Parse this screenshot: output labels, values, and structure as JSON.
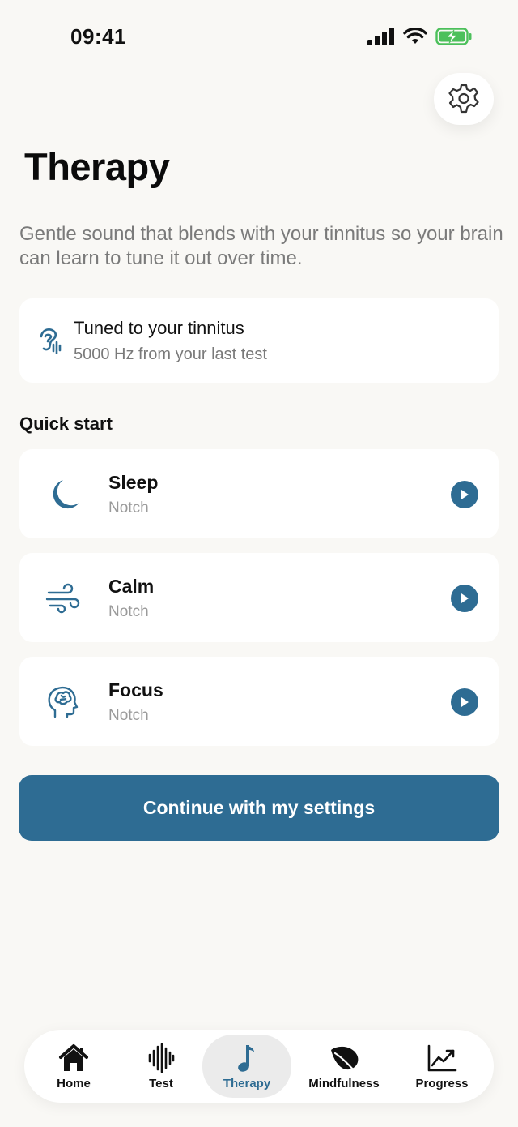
{
  "status_bar": {
    "time": "09:41"
  },
  "header": {
    "title": "Therapy"
  },
  "description": "Gentle sound that blends with your tinnitus so your brain can learn to tune it out over time.",
  "tuned_card": {
    "icon": "ear-sound-icon",
    "title": "Tuned to your tinnitus",
    "subtitle": "5000 Hz from your last test"
  },
  "quick_start": {
    "heading": "Quick start",
    "items": [
      {
        "title": "Sleep",
        "subtitle": "Notch",
        "icon": "moon-icon"
      },
      {
        "title": "Calm",
        "subtitle": "Notch",
        "icon": "wind-icon"
      },
      {
        "title": "Focus",
        "subtitle": "Notch",
        "icon": "brain-head-icon"
      }
    ]
  },
  "continue_button": {
    "label": "Continue with my settings"
  },
  "tab_bar": {
    "active": "Therapy",
    "items": [
      {
        "label": "Home",
        "icon": "home-icon"
      },
      {
        "label": "Test",
        "icon": "waveform-icon"
      },
      {
        "label": "Therapy",
        "icon": "music-note-icon"
      },
      {
        "label": "Mindfulness",
        "icon": "leaf-icon"
      },
      {
        "label": "Progress",
        "icon": "chart-trend-icon"
      }
    ]
  },
  "colors": {
    "accent": "#2e6c93",
    "background": "#f9f8f5",
    "card": "#ffffff",
    "muted_text": "#7a7a7a"
  }
}
